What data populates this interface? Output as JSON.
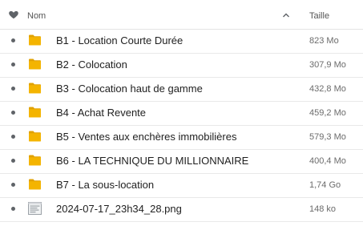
{
  "header": {
    "favorite_icon": "heart-icon",
    "name_label": "Nom",
    "sort_icon": "chevron-up-icon",
    "size_label": "Taille"
  },
  "files": [
    {
      "name": "B1 - Location Courte Durée",
      "size": "823 Mo",
      "type": "folder"
    },
    {
      "name": "B2 - Colocation",
      "size": "307,9 Mo",
      "type": "folder"
    },
    {
      "name": "B3 - Colocation haut de gamme",
      "size": "432,8 Mo",
      "type": "folder"
    },
    {
      "name": "B4 - Achat Revente",
      "size": "459,2 Mo",
      "type": "folder"
    },
    {
      "name": "B5 - Ventes aux enchères immobilières",
      "size": "579,3 Mo",
      "type": "folder"
    },
    {
      "name": "B6 - LA TECHNIQUE DU MILLIONNAIRE",
      "size": "400,4 Mo",
      "type": "folder"
    },
    {
      "name": "B7 - La sous-location",
      "size": "1,74 Go",
      "type": "folder"
    },
    {
      "name": "2024-07-17_23h34_28.png",
      "size": "148 ko",
      "type": "image"
    }
  ],
  "colors": {
    "folder": "#f4b400",
    "folder_dark": "#e0a100",
    "bullet": "#5f6368"
  }
}
